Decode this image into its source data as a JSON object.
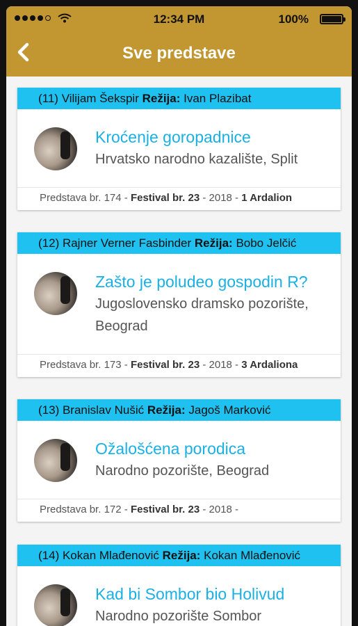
{
  "status_bar": {
    "time": "12:34 PM",
    "battery": "100%"
  },
  "nav": {
    "title": "Sve predstave"
  },
  "labels": {
    "rezija": "Režija:",
    "festival": "Festival br.",
    "predstava": "Predstava br."
  },
  "cards": [
    {
      "head_prefix": "(11) Vilijam Šekspir",
      "director": "Ivan Plazibat",
      "title": "Kroćenje goropadnice",
      "venue": "Hrvatsko narodno kazalište, Split",
      "number": "174",
      "festival": "23",
      "year": "2018",
      "awards": "1 Ardalion"
    },
    {
      "head_prefix": "(12) Rajner Verner Fasbinder",
      "director": "Bobo Jelčić",
      "title": "Zašto je poludeo gospodin R?",
      "venue": "Jugoslovensko dramsko pozorište, Beograd",
      "number": "173",
      "festival": "23",
      "year": "2018",
      "awards": "3 Ardaliona"
    },
    {
      "head_prefix": "(13) Branislav Nušić",
      "director": "Jagoš Marković",
      "title": "Ožalošćena porodica",
      "venue": "Narodno pozorište, Beograd",
      "number": "172",
      "festival": "23",
      "year": "2018",
      "awards": ""
    },
    {
      "head_prefix": "(14) Kokan Mlađenović",
      "director": "Kokan Mlađenović",
      "title": "Kad bi Sombor bio Holivud",
      "venue": "Narodno pozorište Sombor",
      "number": "",
      "festival": "",
      "year": "",
      "awards": ""
    }
  ]
}
